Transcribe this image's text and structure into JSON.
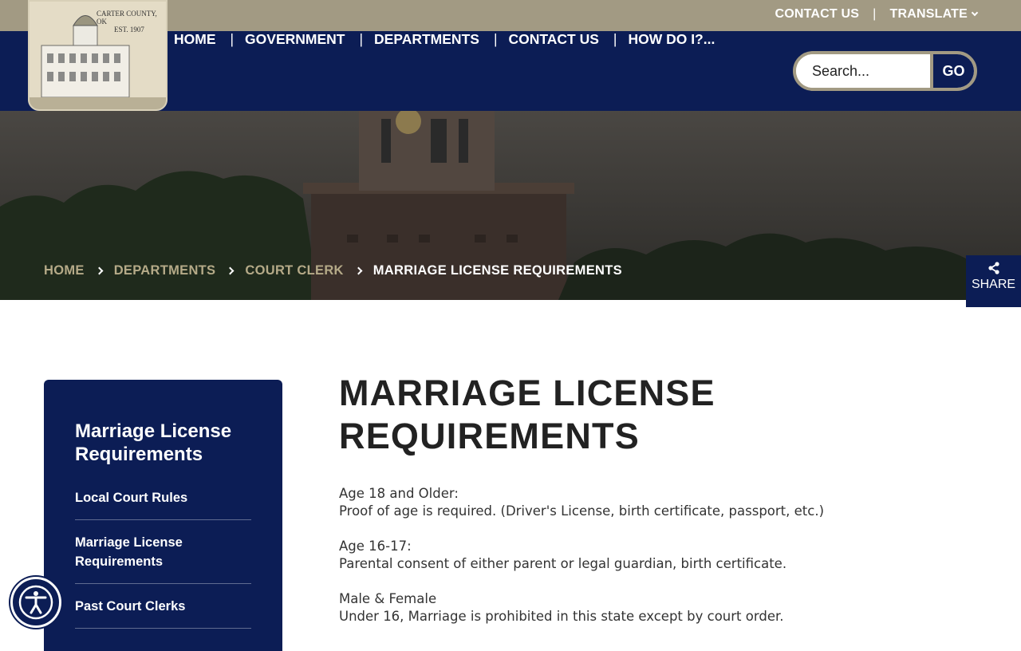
{
  "topbar": {
    "contact_label": "CONTACT US",
    "separator": "|",
    "translate_label": "TRANSLATE"
  },
  "logo": {
    "county_text": "CARTER COUNTY, OK",
    "est_text": "EST. 1907"
  },
  "nav": {
    "items": [
      "HOME",
      "GOVERNMENT",
      "DEPARTMENTS",
      "CONTACT US",
      "HOW DO I?..."
    ],
    "separator": "|"
  },
  "search": {
    "placeholder": "Search...",
    "button_label": "GO"
  },
  "breadcrumb": {
    "items": [
      "HOME",
      "DEPARTMENTS",
      "COURT CLERK"
    ],
    "current": "MARRIAGE LICENSE REQUIREMENTS"
  },
  "share": {
    "label": "SHARE",
    "icon": "share-icon"
  },
  "sidebar": {
    "title": "Marriage License Requirements",
    "items": [
      "Local Court Rules",
      "Marriage License Requirements",
      "Past Court Clerks"
    ]
  },
  "content": {
    "title": "MARRIAGE LICENSE REQUIREMENTS",
    "sections": [
      {
        "heading": "Age 18 and Older:",
        "text": "Proof of age is required. (Driver's License, birth certificate, passport, etc.)"
      },
      {
        "heading": "Age 16-17:",
        "text": "Parental consent of either parent or legal guardian, birth certificate."
      },
      {
        "heading": "Male & Female",
        "text": "Under 16, Marriage is prohibited in this state except by court order."
      }
    ]
  },
  "accessibility": {
    "icon": "accessibility-icon"
  },
  "colors": {
    "navy": "#0c1d55",
    "tan": "#a29a83",
    "crumb": "#b5aa88"
  }
}
